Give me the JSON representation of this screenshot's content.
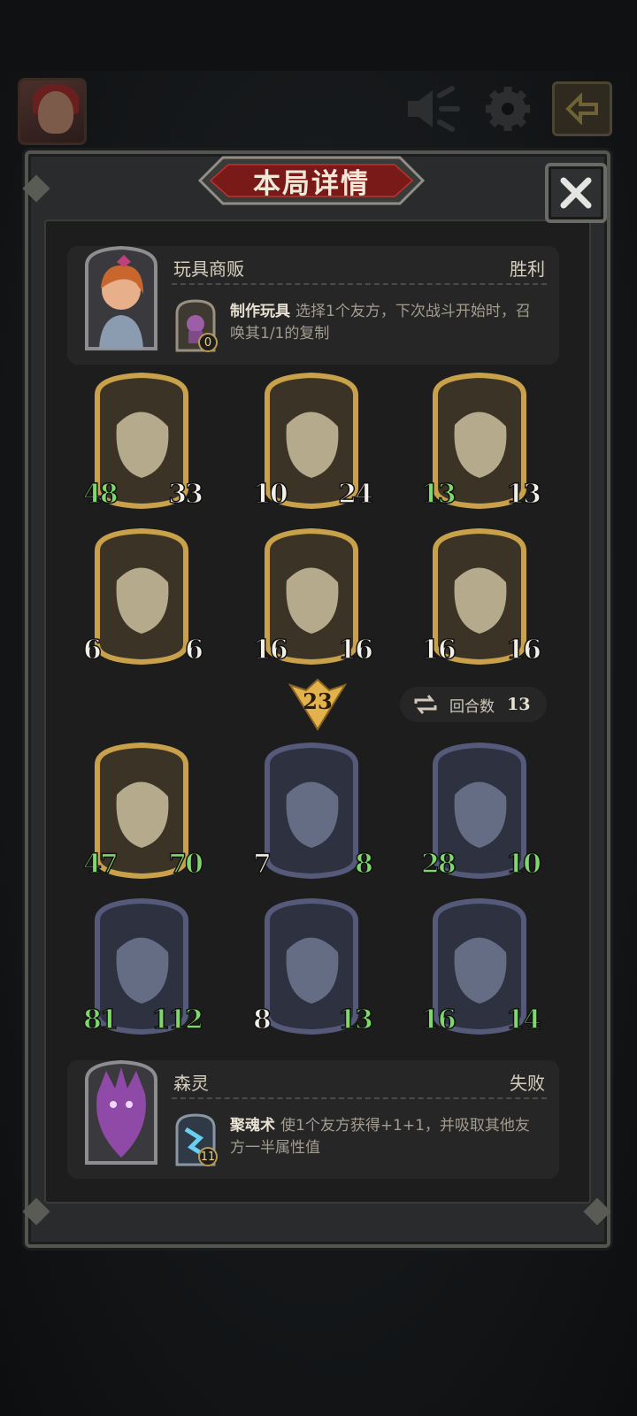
{
  "dialog": {
    "title": "本局详情"
  },
  "player_top": {
    "name": "玩具商贩",
    "result": "胜利",
    "skill_name": "制作玩具",
    "skill_desc": "选择1个友方，下次战斗开始时，召唤其1/1的复制",
    "skill_cost": "0"
  },
  "player_bottom": {
    "name": "森灵",
    "result": "失败",
    "skill_name": "聚魂术",
    "skill_desc": "使1个友方获得+1+1，并吸取其他友方一半属性值",
    "skill_cost": "11"
  },
  "top_board": [
    {
      "name": "bone-dragon",
      "atk": "48",
      "hp": "33",
      "frame": "gold"
    },
    {
      "name": "skeleton-warlock",
      "atk": "10",
      "hp": "24",
      "frame": "gold"
    },
    {
      "name": "clown-toy",
      "atk": "13",
      "hp": "13",
      "frame": "gold"
    },
    {
      "name": "zeppelin",
      "atk": "6",
      "hp": "6",
      "frame": "gold"
    },
    {
      "name": "bone-dragon",
      "atk": "16",
      "hp": "16",
      "frame": "gold"
    },
    {
      "name": "bone-dragon",
      "atk": "16",
      "hp": "16",
      "frame": "gold"
    }
  ],
  "damage_badge": "23",
  "rounds": {
    "label": "回合数",
    "value": "13"
  },
  "bottom_board": [
    {
      "name": "brute",
      "atk": "47",
      "hp": "70",
      "frame": "gold"
    },
    {
      "name": "hooded-guard",
      "atk": "7",
      "hp": "8",
      "frame": "steel"
    },
    {
      "name": "dark-knight",
      "atk": "28",
      "hp": "10",
      "frame": "steel"
    },
    {
      "name": "armored-warrior",
      "atk": "81",
      "hp": "112",
      "frame": "steel"
    },
    {
      "name": "armored-warrior",
      "atk": "8",
      "hp": "13",
      "frame": "steel"
    },
    {
      "name": "cursed-sword",
      "atk": "16",
      "hp": "14",
      "frame": "steel"
    }
  ],
  "colors": {
    "gold_frame": "#c9a14a",
    "steel_frame": "#555a7a",
    "green_stat": "#7fd86b",
    "title_red": "#7a1a18"
  }
}
